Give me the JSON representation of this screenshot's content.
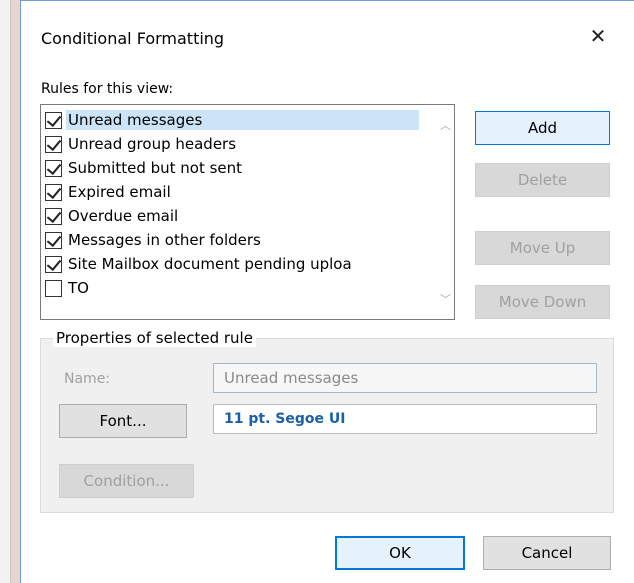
{
  "dialog": {
    "title": "Conditional Formatting",
    "close_glyph": "✕"
  },
  "rules": {
    "label": "Rules for this view:",
    "items": [
      {
        "label": "Unread messages",
        "checked": true,
        "selected": true
      },
      {
        "label": "Unread group headers",
        "checked": true,
        "selected": false
      },
      {
        "label": "Submitted but not sent",
        "checked": true,
        "selected": false
      },
      {
        "label": "Expired email",
        "checked": true,
        "selected": false
      },
      {
        "label": "Overdue email",
        "checked": true,
        "selected": false
      },
      {
        "label": "Messages in other folders",
        "checked": true,
        "selected": false
      },
      {
        "label": "Site Mailbox document pending uploa",
        "checked": true,
        "selected": false
      },
      {
        "label": "TO",
        "checked": false,
        "selected": false
      }
    ]
  },
  "buttons": {
    "add": "Add",
    "delete": "Delete",
    "move_up": "Move Up",
    "move_down": "Move Down",
    "font": "Font...",
    "condition": "Condition...",
    "ok": "OK",
    "cancel": "Cancel"
  },
  "properties": {
    "label": "Properties of selected rule",
    "name_label": "Name:",
    "name_value": "Unread messages",
    "font_value": "11 pt. Segoe UI"
  },
  "colors": {
    "selection": "#cce4f7",
    "primary_border": "#0078d7",
    "font_value_text": "#1a5fa8"
  }
}
